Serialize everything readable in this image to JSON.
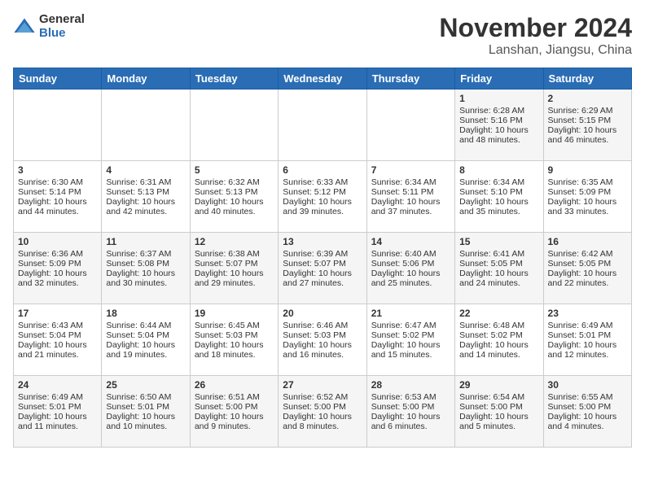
{
  "logo": {
    "general": "General",
    "blue": "Blue"
  },
  "header": {
    "month": "November 2024",
    "location": "Lanshan, Jiangsu, China"
  },
  "days_of_week": [
    "Sunday",
    "Monday",
    "Tuesday",
    "Wednesday",
    "Thursday",
    "Friday",
    "Saturday"
  ],
  "weeks": [
    [
      {
        "day": "",
        "info": ""
      },
      {
        "day": "",
        "info": ""
      },
      {
        "day": "",
        "info": ""
      },
      {
        "day": "",
        "info": ""
      },
      {
        "day": "",
        "info": ""
      },
      {
        "day": "1",
        "info": "Sunrise: 6:28 AM\nSunset: 5:16 PM\nDaylight: 10 hours\nand 48 minutes."
      },
      {
        "day": "2",
        "info": "Sunrise: 6:29 AM\nSunset: 5:15 PM\nDaylight: 10 hours\nand 46 minutes."
      }
    ],
    [
      {
        "day": "3",
        "info": "Sunrise: 6:30 AM\nSunset: 5:14 PM\nDaylight: 10 hours\nand 44 minutes."
      },
      {
        "day": "4",
        "info": "Sunrise: 6:31 AM\nSunset: 5:13 PM\nDaylight: 10 hours\nand 42 minutes."
      },
      {
        "day": "5",
        "info": "Sunrise: 6:32 AM\nSunset: 5:13 PM\nDaylight: 10 hours\nand 40 minutes."
      },
      {
        "day": "6",
        "info": "Sunrise: 6:33 AM\nSunset: 5:12 PM\nDaylight: 10 hours\nand 39 minutes."
      },
      {
        "day": "7",
        "info": "Sunrise: 6:34 AM\nSunset: 5:11 PM\nDaylight: 10 hours\nand 37 minutes."
      },
      {
        "day": "8",
        "info": "Sunrise: 6:34 AM\nSunset: 5:10 PM\nDaylight: 10 hours\nand 35 minutes."
      },
      {
        "day": "9",
        "info": "Sunrise: 6:35 AM\nSunset: 5:09 PM\nDaylight: 10 hours\nand 33 minutes."
      }
    ],
    [
      {
        "day": "10",
        "info": "Sunrise: 6:36 AM\nSunset: 5:09 PM\nDaylight: 10 hours\nand 32 minutes."
      },
      {
        "day": "11",
        "info": "Sunrise: 6:37 AM\nSunset: 5:08 PM\nDaylight: 10 hours\nand 30 minutes."
      },
      {
        "day": "12",
        "info": "Sunrise: 6:38 AM\nSunset: 5:07 PM\nDaylight: 10 hours\nand 29 minutes."
      },
      {
        "day": "13",
        "info": "Sunrise: 6:39 AM\nSunset: 5:07 PM\nDaylight: 10 hours\nand 27 minutes."
      },
      {
        "day": "14",
        "info": "Sunrise: 6:40 AM\nSunset: 5:06 PM\nDaylight: 10 hours\nand 25 minutes."
      },
      {
        "day": "15",
        "info": "Sunrise: 6:41 AM\nSunset: 5:05 PM\nDaylight: 10 hours\nand 24 minutes."
      },
      {
        "day": "16",
        "info": "Sunrise: 6:42 AM\nSunset: 5:05 PM\nDaylight: 10 hours\nand 22 minutes."
      }
    ],
    [
      {
        "day": "17",
        "info": "Sunrise: 6:43 AM\nSunset: 5:04 PM\nDaylight: 10 hours\nand 21 minutes."
      },
      {
        "day": "18",
        "info": "Sunrise: 6:44 AM\nSunset: 5:04 PM\nDaylight: 10 hours\nand 19 minutes."
      },
      {
        "day": "19",
        "info": "Sunrise: 6:45 AM\nSunset: 5:03 PM\nDaylight: 10 hours\nand 18 minutes."
      },
      {
        "day": "20",
        "info": "Sunrise: 6:46 AM\nSunset: 5:03 PM\nDaylight: 10 hours\nand 16 minutes."
      },
      {
        "day": "21",
        "info": "Sunrise: 6:47 AM\nSunset: 5:02 PM\nDaylight: 10 hours\nand 15 minutes."
      },
      {
        "day": "22",
        "info": "Sunrise: 6:48 AM\nSunset: 5:02 PM\nDaylight: 10 hours\nand 14 minutes."
      },
      {
        "day": "23",
        "info": "Sunrise: 6:49 AM\nSunset: 5:01 PM\nDaylight: 10 hours\nand 12 minutes."
      }
    ],
    [
      {
        "day": "24",
        "info": "Sunrise: 6:49 AM\nSunset: 5:01 PM\nDaylight: 10 hours\nand 11 minutes."
      },
      {
        "day": "25",
        "info": "Sunrise: 6:50 AM\nSunset: 5:01 PM\nDaylight: 10 hours\nand 10 minutes."
      },
      {
        "day": "26",
        "info": "Sunrise: 6:51 AM\nSunset: 5:00 PM\nDaylight: 10 hours\nand 9 minutes."
      },
      {
        "day": "27",
        "info": "Sunrise: 6:52 AM\nSunset: 5:00 PM\nDaylight: 10 hours\nand 8 minutes."
      },
      {
        "day": "28",
        "info": "Sunrise: 6:53 AM\nSunset: 5:00 PM\nDaylight: 10 hours\nand 6 minutes."
      },
      {
        "day": "29",
        "info": "Sunrise: 6:54 AM\nSunset: 5:00 PM\nDaylight: 10 hours\nand 5 minutes."
      },
      {
        "day": "30",
        "info": "Sunrise: 6:55 AM\nSunset: 5:00 PM\nDaylight: 10 hours\nand 4 minutes."
      }
    ]
  ]
}
